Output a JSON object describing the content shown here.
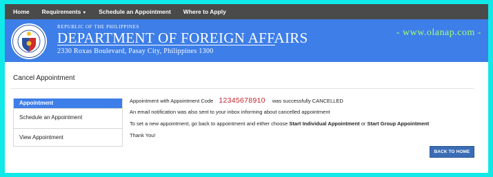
{
  "nav": {
    "home": "Home",
    "requirements": "Requirements",
    "schedule": "Schedule an Appointment",
    "where": "Where to Apply"
  },
  "banner": {
    "republic": "REPUBLIC OF THE PHILIPPINES",
    "department": "DEPARTMENT OF FOREIGN AFFAIRS",
    "address": "2330 Roxas Boulevard, Pasay City, Philippines 1300",
    "watermark": "- www.olanap.com -"
  },
  "page": {
    "title": "Cancel Appointment"
  },
  "sidebar": {
    "heading": "Appointment",
    "items": [
      {
        "label": "Schedule an Appointment"
      },
      {
        "label": "View Appointment"
      }
    ]
  },
  "message": {
    "prefix": "Appointment with Appointment Code",
    "code": "12345678910",
    "suffix": "was successfully CANCELLED",
    "email_note": "An email notification was also sent to your inbox informing about cancelled appointment",
    "new_prefix": "To set a new appointment, go back to appointment and either choose",
    "individual": "Start Individual Appointment",
    "or": "or",
    "group": "Start Group Appointment",
    "thanks": "Thank You!"
  },
  "buttons": {
    "back_home": "BACK TO HOME"
  },
  "colors": {
    "accent": "#3d7ee8",
    "code": "#c0212a",
    "frame": "#11e8e8",
    "navbar": "#4a4a4a"
  }
}
